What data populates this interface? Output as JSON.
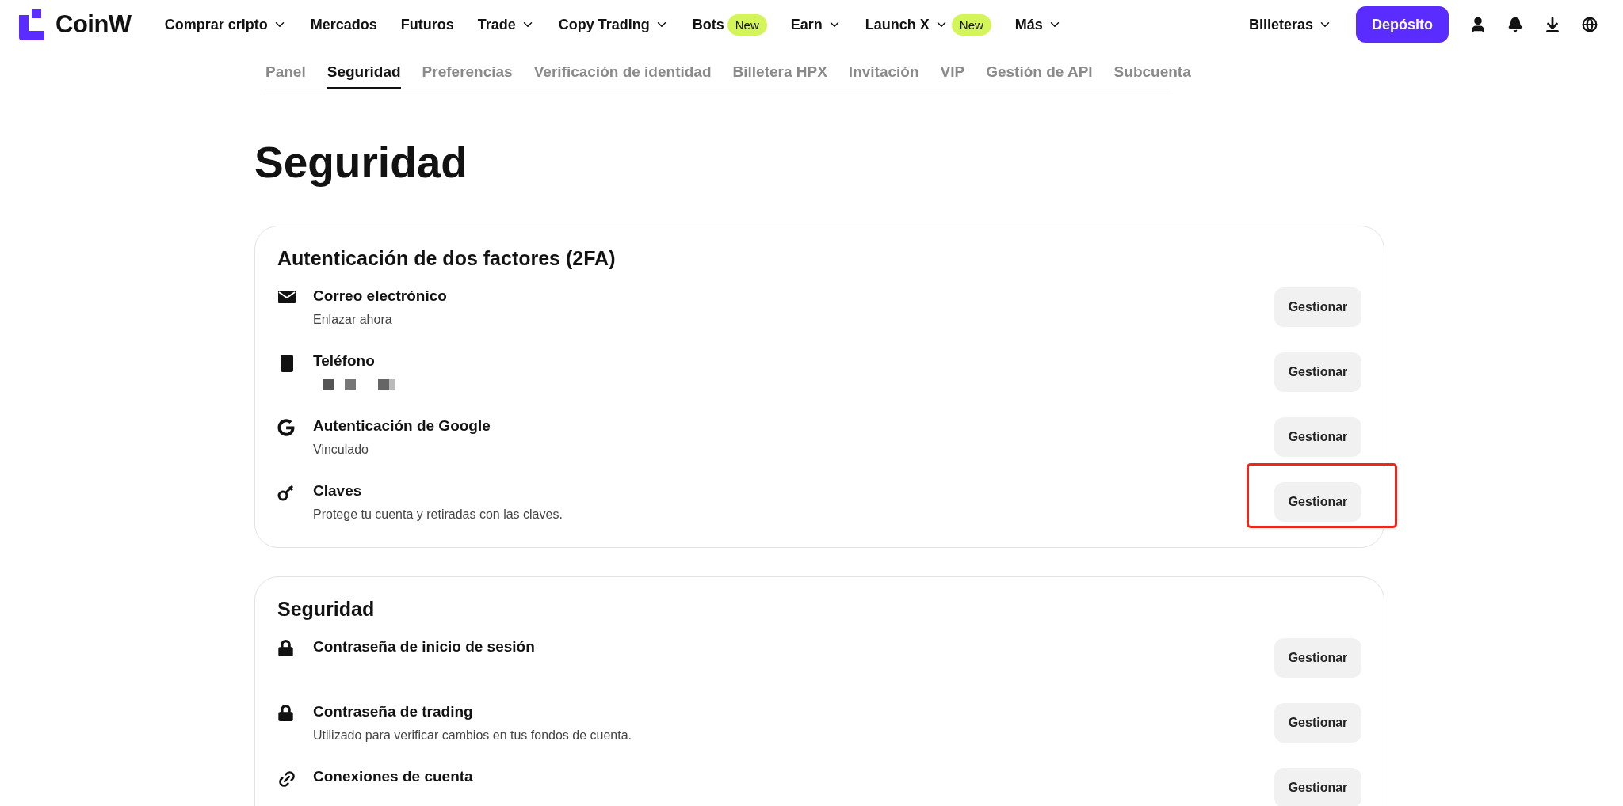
{
  "header": {
    "logo": "CoinW",
    "nav": [
      {
        "label": "Comprar cripto",
        "dropdown": true
      },
      {
        "label": "Mercados",
        "dropdown": false
      },
      {
        "label": "Futuros",
        "dropdown": false
      },
      {
        "label": "Trade",
        "dropdown": true
      },
      {
        "label": "Copy Trading",
        "dropdown": true
      },
      {
        "label": "Bots",
        "dropdown": false,
        "badge": "New"
      },
      {
        "label": "Earn",
        "dropdown": true
      },
      {
        "label": "Launch X",
        "dropdown": true,
        "badge": "New"
      },
      {
        "label": "Más",
        "dropdown": true
      }
    ],
    "wallets": "Billeteras",
    "deposit": "Depósito"
  },
  "subtabs": [
    {
      "label": "Panel",
      "selected": false
    },
    {
      "label": "Seguridad",
      "selected": true
    },
    {
      "label": "Preferencias",
      "selected": false
    },
    {
      "label": "Verificación de identidad",
      "selected": false
    },
    {
      "label": "Billetera HPX",
      "selected": false
    },
    {
      "label": "Invitación",
      "selected": false
    },
    {
      "label": "VIP",
      "selected": false
    },
    {
      "label": "Gestión de API",
      "selected": false
    },
    {
      "label": "Subcuenta",
      "selected": false
    }
  ],
  "page_title": "Seguridad",
  "sections": [
    {
      "title": "Autenticación de dos factores (2FA)",
      "rows": [
        {
          "kind": "mail",
          "title": "Correo electrónico",
          "subtitle": "Enlazar ahora",
          "button": "Gestionar",
          "highlighted": false
        },
        {
          "kind": "phone",
          "title": "Teléfono",
          "redacted": true,
          "button": "Gestionar",
          "highlighted": false
        },
        {
          "kind": "google",
          "title": "Autenticación de Google",
          "subtitle": "Vinculado",
          "button": "Gestionar",
          "highlighted": false
        },
        {
          "kind": "key",
          "title": "Claves",
          "subtitle": "Protege tu cuenta y retiradas con las claves.",
          "button": "Gestionar",
          "highlighted": true
        }
      ]
    },
    {
      "title": "Seguridad",
      "rows": [
        {
          "kind": "lock",
          "title": "Contraseña de inicio de sesión",
          "button": "Gestionar",
          "highlighted": false
        },
        {
          "kind": "lock",
          "title": "Contraseña de trading",
          "subtitle": "Utilizado para verificar cambios en tus fondos de cuenta.",
          "button": "Gestionar",
          "highlighted": false
        },
        {
          "kind": "link",
          "title": "Conexiones de cuenta",
          "button": "Gestionar",
          "highlighted": false
        }
      ]
    }
  ]
}
